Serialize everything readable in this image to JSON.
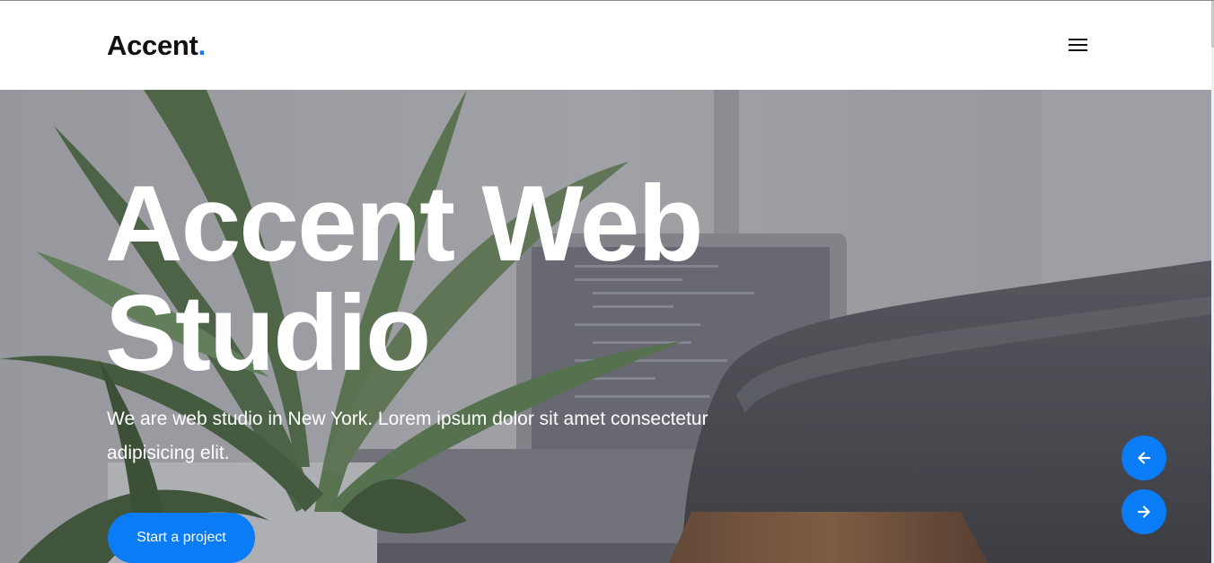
{
  "brand": {
    "name": "Accent",
    "dot": ".",
    "accent_color": "#0a7cf6"
  },
  "header": {
    "menu_icon": "hamburger-menu-icon"
  },
  "hero": {
    "title_line1": "Accent Web",
    "title_line2": "Studio",
    "subtitle": "We are web studio in New York. Lorem ipsum dolor sit amet consectetur adipisicing elit.",
    "cta_label": "Start a project",
    "background": "desk-scene-with-plant-laptop-chair"
  },
  "slider": {
    "prev_icon": "arrow-left-icon",
    "next_icon": "arrow-right-icon"
  }
}
